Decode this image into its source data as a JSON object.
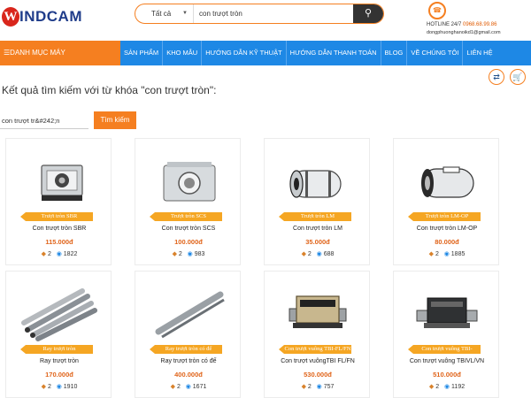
{
  "header": {
    "logo": "WINDCAM",
    "logo_initial": "W",
    "logo_rest": "INDCAM",
    "search_category": "Tất cả",
    "search_query": "con trượt tròn",
    "hotline_label": "HOTLINE 24/7",
    "hotline_number": "0968.68.99.86",
    "email": "dongphuonghanoikd1@gmail.com"
  },
  "nav": {
    "category_label": "DANH MỤC MÁY",
    "items": [
      "SẢN PHẨM",
      "KHO MẪU",
      "HƯỚNG DẪN KỸ THUẬT",
      "HƯỚNG DẪN THANH TOÁN",
      "BLOG",
      "VỀ CHÚNG TÔI",
      "LIÊN HỆ"
    ]
  },
  "search_result": {
    "title": "Kết quả tìm kiếm với từ khóa \"con trượt tròn\":",
    "input_value": "con trượt tr&#242;n",
    "button_label": "Tìm kiếm"
  },
  "products": [
    {
      "tag": "Trượt tròn SBR",
      "name": "Con trượt tròn SBR",
      "price": "115.000đ",
      "count": "2",
      "views": "1822"
    },
    {
      "tag": "Trượt tròn SCS",
      "name": "Con trượt tròn SCS",
      "price": "100.000đ",
      "count": "2",
      "views": "983"
    },
    {
      "tag": "Trượt tròn LM",
      "name": "Con trượt tròn LM",
      "price": "35.000đ",
      "count": "2",
      "views": "688"
    },
    {
      "tag": "Trượt tròn LM-OP",
      "name": "Con trượt tròn LM-OP",
      "price": "80.000đ",
      "count": "2",
      "views": "1885"
    },
    {
      "tag": "Ray trượt tròn",
      "name": "Ray trượt tròn",
      "price": "170.000đ",
      "count": "2",
      "views": "1910"
    },
    {
      "tag": "Ray trượt tròn có đế",
      "name": "Ray trượt tròn có đế",
      "price": "400.000đ",
      "count": "2",
      "views": "1671"
    },
    {
      "tag": "Con trượt vuông TBI-FL/FN",
      "name": "Con trượt vuôngTBI FL/FN",
      "price": "530.000đ",
      "count": "2",
      "views": "757"
    },
    {
      "tag": "Con trượt vuông TBI-VL/VN",
      "name": "Con trượt vuông TBIVL/VN",
      "price": "510.000đ",
      "count": "2",
      "views": "1192"
    }
  ]
}
